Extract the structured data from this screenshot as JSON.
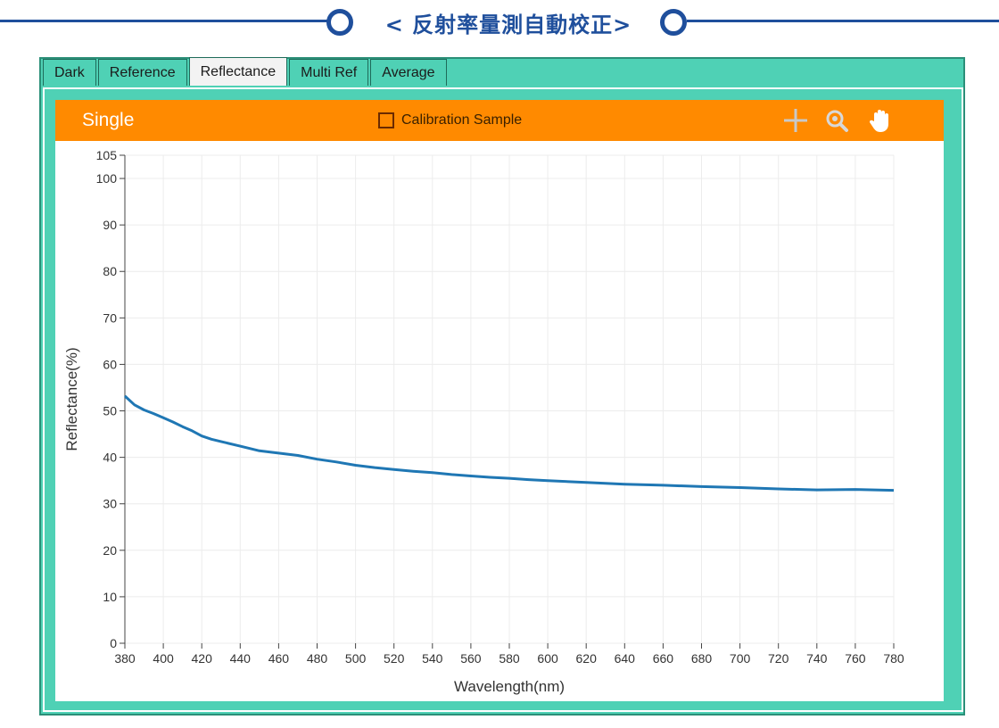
{
  "header": {
    "title": "< 反射率量測自動校正>",
    "accent_color": "#1f4f9c"
  },
  "tabs": [
    {
      "label": "Dark",
      "active": false
    },
    {
      "label": "Reference",
      "active": false
    },
    {
      "label": "Reflectance",
      "active": true
    },
    {
      "label": "Multi Ref",
      "active": false
    },
    {
      "label": "Average",
      "active": false
    }
  ],
  "toolbar": {
    "title": "Single",
    "calibration_label": "Calibration Sample",
    "calibration_checked": false,
    "icons": [
      "crosshair-icon",
      "zoom-icon",
      "pan-hand-icon"
    ],
    "color": "#ff8a00"
  },
  "chart_data": {
    "type": "line",
    "title": "",
    "xlabel": "Wavelength(nm)",
    "ylabel": "Reflectance(%)",
    "xlim": [
      380,
      780
    ],
    "ylim": [
      0,
      105
    ],
    "xticks": [
      380,
      400,
      420,
      440,
      460,
      480,
      500,
      520,
      540,
      560,
      580,
      600,
      620,
      640,
      660,
      680,
      700,
      720,
      740,
      760,
      780
    ],
    "yticks": [
      0,
      10,
      20,
      30,
      40,
      50,
      60,
      70,
      80,
      90,
      100,
      105
    ],
    "grid": true,
    "series": [
      {
        "color": "#1f77b4",
        "x": [
          380,
          385,
          390,
          395,
          400,
          405,
          410,
          415,
          420,
          425,
          430,
          440,
          450,
          460,
          470,
          480,
          490,
          500,
          510,
          520,
          530,
          540,
          550,
          560,
          570,
          580,
          590,
          600,
          620,
          640,
          660,
          680,
          700,
          720,
          740,
          760,
          780
        ],
        "y": [
          53.2,
          51.3,
          50.2,
          49.4,
          48.5,
          47.6,
          46.6,
          45.7,
          44.6,
          43.9,
          43.4,
          42.4,
          41.4,
          40.9,
          40.4,
          39.6,
          39.0,
          38.3,
          37.8,
          37.4,
          37.0,
          36.7,
          36.3,
          36.0,
          35.7,
          35.5,
          35.2,
          35.0,
          34.6,
          34.2,
          34.0,
          33.7,
          33.5,
          33.2,
          33.0,
          33.1,
          32.9
        ]
      }
    ]
  }
}
